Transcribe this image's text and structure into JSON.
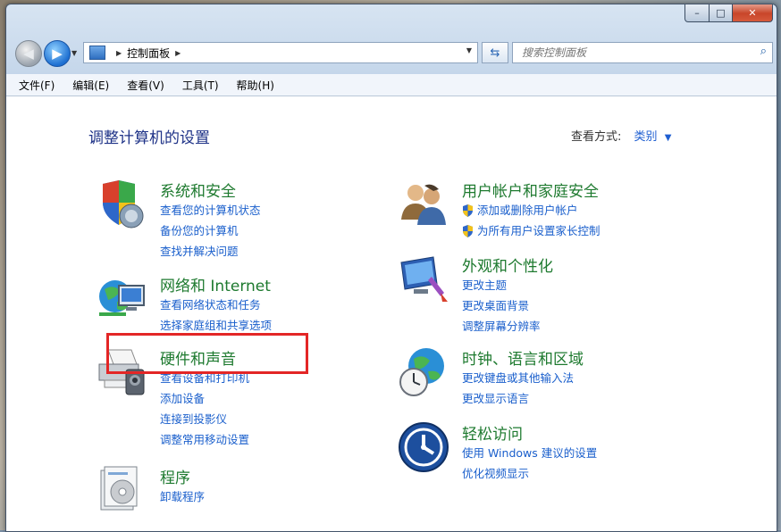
{
  "window": {
    "controls": {
      "minimize": "–",
      "maximize": "□",
      "close": "✕"
    }
  },
  "address_bar": {
    "path": "控制面板",
    "icon": "control-panel-icon"
  },
  "search": {
    "placeholder": "搜索控制面板"
  },
  "menu": [
    "文件(F)",
    "编辑(E)",
    "查看(V)",
    "工具(T)",
    "帮助(H)"
  ],
  "main": {
    "heading": "调整计算机的设置",
    "view_by_label": "查看方式:",
    "view_by_value": "类别"
  },
  "categories_left": [
    {
      "title": "系统和安全",
      "icon": "shield-computer-icon",
      "links": [
        "查看您的计算机状态",
        "备份您的计算机",
        "查找并解决问题"
      ]
    },
    {
      "title": "网络和 Internet",
      "icon": "network-globe-icon",
      "links": [
        "查看网络状态和任务",
        "选择家庭组和共享选项"
      ]
    },
    {
      "title": "硬件和声音",
      "icon": "printer-speaker-icon",
      "links": [
        "查看设备和打印机",
        "添加设备",
        "连接到投影仪",
        "调整常用移动设置"
      ]
    },
    {
      "title": "程序",
      "icon": "programs-icon",
      "links": [
        "卸载程序"
      ]
    }
  ],
  "categories_right": [
    {
      "title": "用户帐户和家庭安全",
      "icon": "users-icon",
      "links": [
        "添加或删除用户帐户",
        "为所有用户设置家长控制"
      ]
    },
    {
      "title": "外观和个性化",
      "icon": "monitor-brush-icon",
      "links": [
        "更改主题",
        "更改桌面背景",
        "调整屏幕分辨率"
      ]
    },
    {
      "title": "时钟、语言和区域",
      "icon": "clock-globe-icon",
      "links": [
        "更改键盘或其他输入法",
        "更改显示语言"
      ]
    },
    {
      "title": "轻松访问",
      "icon": "ease-of-access-icon",
      "links": [
        "使用 Windows 建议的设置",
        "优化视频显示"
      ]
    }
  ],
  "colors": {
    "link": "#1a5fcc",
    "category_title": "#1e7a2f",
    "heading": "#1e3287",
    "highlight": "#e32626"
  }
}
